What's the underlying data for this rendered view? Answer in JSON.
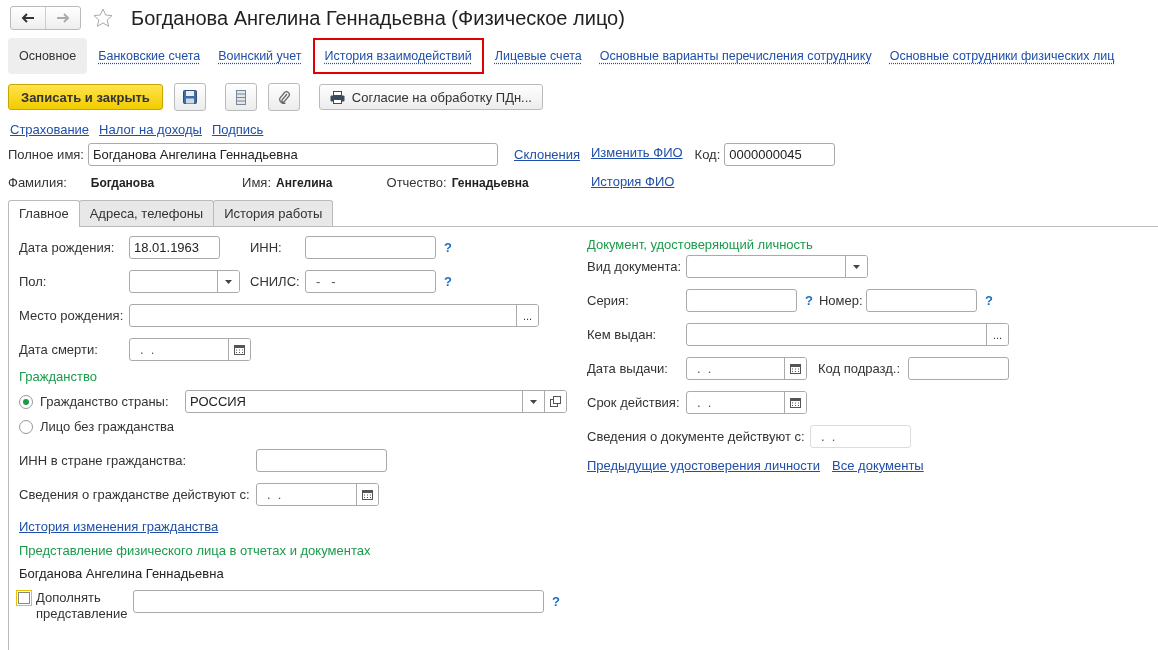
{
  "header": {
    "title": "Богданова Ангелина Геннадьевна (Физическое лицо)"
  },
  "sections": [
    {
      "label": "Основное",
      "selected": true,
      "highlighted": false
    },
    {
      "label": "Банковские счета",
      "selected": false,
      "highlighted": false
    },
    {
      "label": "Воинский учет",
      "selected": false,
      "highlighted": false
    },
    {
      "label": "История взаимодействий",
      "selected": false,
      "highlighted": true
    },
    {
      "label": "Лицевые счета",
      "selected": false,
      "highlighted": false
    },
    {
      "label": "Основные варианты перечисления сотруднику",
      "selected": false,
      "highlighted": false
    },
    {
      "label": "Основные сотрудники физических лиц",
      "selected": false,
      "highlighted": false
    }
  ],
  "toolbar": {
    "save_close": "Записать и закрыть",
    "print_button": "Согласие на обработку ПДн..."
  },
  "top_links": [
    "Страхование",
    "Налог на доходы",
    "Подпись"
  ],
  "full_name": {
    "label": "Полное имя:",
    "value": "Богданова Ангелина Геннадьевна",
    "link": "Склонения"
  },
  "change_name_link": "Изменить ФИО",
  "code": {
    "label": "Код:",
    "value": "0000000045"
  },
  "name_history_link": "История ФИО",
  "name_parts": [
    {
      "label": "Фамилия:",
      "value": "Богданова"
    },
    {
      "label": "Имя:",
      "value": "Ангелина"
    },
    {
      "label": "Отчество:",
      "value": "Геннадьевна"
    }
  ],
  "tabs": [
    {
      "label": "Главное",
      "selected": true
    },
    {
      "label": "Адреса, телефоны",
      "selected": false
    },
    {
      "label": "История работы",
      "selected": false
    }
  ],
  "main": {
    "birth_date": {
      "label": "Дата рождения:",
      "kind": "text",
      "value": "18.01.1963"
    },
    "inn": {
      "label": "ИНН:",
      "kind": "text",
      "help": "?"
    },
    "gender": {
      "label": "Пол:",
      "kind": "select"
    },
    "snils": {
      "label": "СНИЛС:",
      "kind": "text",
      "value": "-   -",
      "help": "?"
    },
    "birth_place": {
      "label": "Место рождения:",
      "kind": "choice",
      "button": "..."
    },
    "death_date": {
      "label": "Дата смерти:",
      "kind": "date",
      "value": ".  ."
    },
    "citizenship_heading": "Гражданство",
    "citizenship_options": [
      {
        "label": "Гражданство страны:",
        "selected": true
      },
      {
        "label": "Лицо без гражданства",
        "selected": false
      }
    ],
    "country": {
      "kind": "select-open",
      "value": "РОССИЯ"
    },
    "foreign_inn": {
      "label": "ИНН в стране гражданства:",
      "kind": "text"
    },
    "citizenship_since": {
      "label": "Сведения о гражданстве действуют с:",
      "kind": "date",
      "value": ".  ."
    },
    "citizenship_history_link": "История изменения гражданства",
    "presentation_heading": "Представление физического лица в отчетах и документах",
    "presentation_text": "Богданова Ангелина Геннадьевна",
    "supplement": {
      "label": "Дополнять представление",
      "checked": false
    },
    "supplement_field": {
      "kind": "text",
      "help": "?"
    }
  },
  "document": {
    "heading": "Документ, удостоверяющий личность",
    "doc_type": {
      "label": "Вид документа:",
      "kind": "select"
    },
    "series": {
      "label": "Серия:",
      "kind": "text",
      "help": "?"
    },
    "number": {
      "label": "Номер:",
      "kind": "text",
      "help": "?"
    },
    "issued_by": {
      "label": "Кем выдан:",
      "kind": "choice",
      "button": "..."
    },
    "issue_date": {
      "label": "Дата выдачи:",
      "kind": "date",
      "value": ".  ."
    },
    "dept_code": {
      "label": "Код подразд.:",
      "kind": "text"
    },
    "valid_until": {
      "label": "Срок действия:",
      "kind": "date",
      "value": ".  ."
    },
    "valid_since": {
      "label": "Сведения о документе действуют с:",
      "kind": "text",
      "value": ".  .",
      "disabled": true
    },
    "links": [
      "Предыдущие удостоверения личности",
      "Все документы"
    ]
  }
}
